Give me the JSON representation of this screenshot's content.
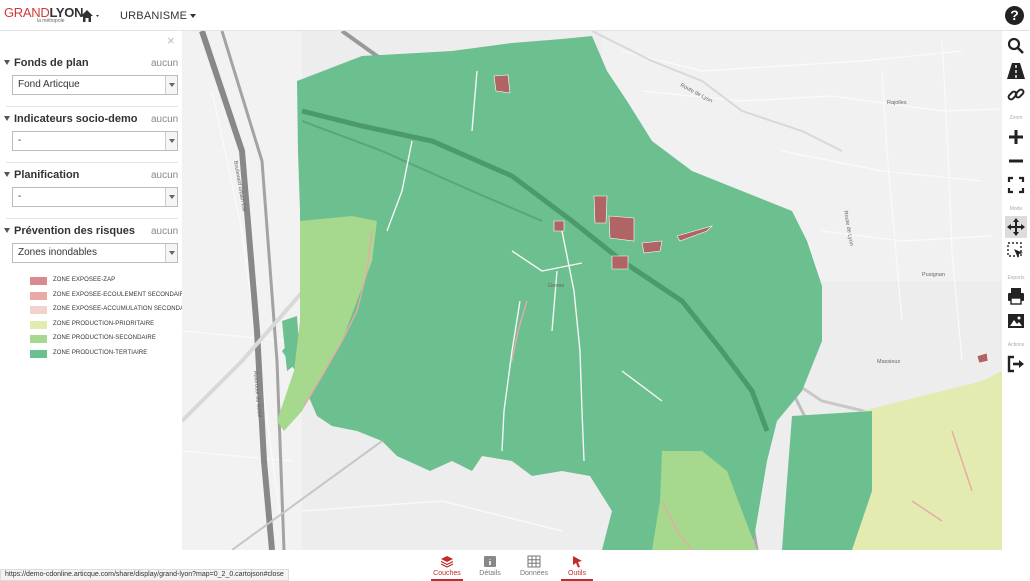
{
  "header": {
    "logo_grand": "GRAND",
    "logo_lyon": "LYON",
    "logo_sub": "la métropole",
    "menu_label": "URBANISME",
    "help_label": "?"
  },
  "panel": {
    "close_label": "×",
    "groups": [
      {
        "title": "Fonds de plan",
        "aucun": "aucun",
        "selected": "Fond Articque"
      },
      {
        "title": "Indicateurs socio-demo",
        "aucun": "aucun",
        "selected": "-"
      },
      {
        "title": "Planification",
        "aucun": "aucun",
        "selected": "-"
      },
      {
        "title": "Prévention des risques",
        "aucun": "aucun",
        "selected": "Zones inondables"
      }
    ],
    "legend": [
      {
        "label": "ZONE EXPOSEE-ZAP",
        "color": "#d98a8f"
      },
      {
        "label": "ZONE EXPOSEE-ECOULEMENT SECONDAIRE",
        "color": "#e7aaa6"
      },
      {
        "label": "ZONE EXPOSEE-ACCUMULATION SECONDAIRE",
        "color": "#f2d3cc"
      },
      {
        "label": "ZONE PRODUCTION-PRIORITAIRE",
        "color": "#e3ebb0"
      },
      {
        "label": "ZONE PRODUCTION-SECONDAIRE",
        "color": "#a6d88d"
      },
      {
        "label": "ZONE PRODUCTION-TERTIAIRE",
        "color": "#6cbf8f"
      }
    ]
  },
  "map": {
    "place_labels": [
      "Genas",
      "Pusignan",
      "Rajolles",
      "Massieux",
      "Route de Lyon",
      "Route de Lyon",
      "Boulevard urbain Est",
      "Autoroute du Soleil"
    ],
    "colors": {
      "tertiaire": "#6cbf8f",
      "secondaire": "#a6d88d",
      "prioritaire": "#e3ebb0",
      "zap": "#b06464",
      "road": "#8a8a8a",
      "base": "#ededed"
    }
  },
  "toolbar": {
    "section_zoom": "Zoom",
    "section_mode": "Mode",
    "section_exports": "Exports",
    "section_actions": "Actions"
  },
  "bottom": {
    "status_url": "https://demo-cdonline.articque.com/share/display/grand-lyon?map=0_2_0.cartojson#close",
    "tabs": [
      {
        "label": "Couches"
      },
      {
        "label": "Détails"
      },
      {
        "label": "Données"
      },
      {
        "label": "Outils"
      }
    ]
  }
}
